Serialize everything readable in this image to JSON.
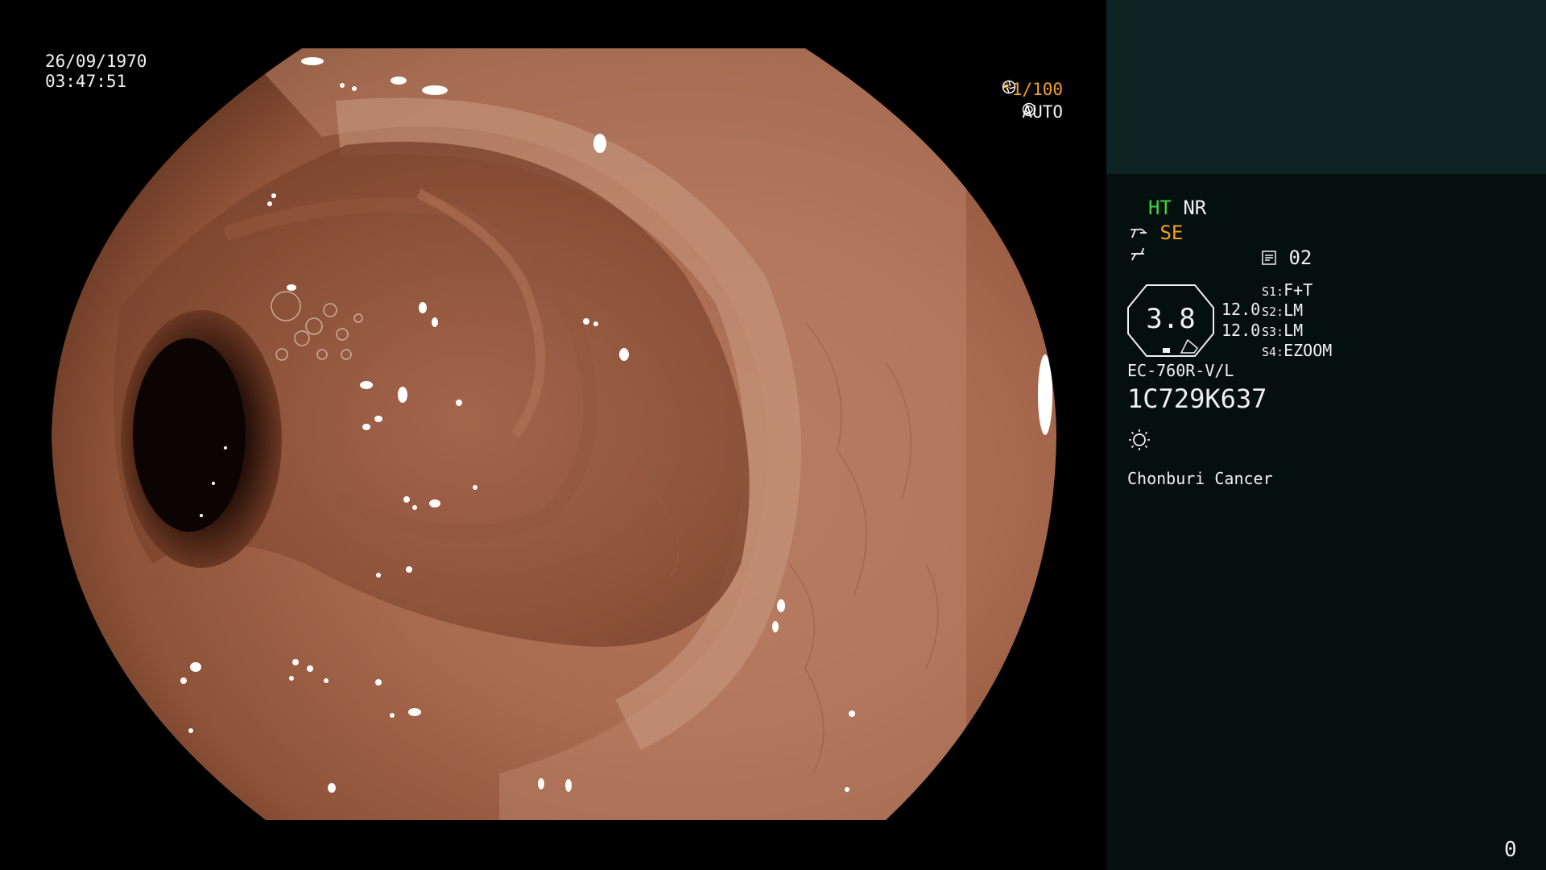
{
  "image_overlay": {
    "date": "26/09/1970",
    "time": "03:47:51",
    "shutter": "*1/100",
    "shutter_icon": "aperture-icon",
    "iris": "AUTO",
    "iris_icon": "iris-icon"
  },
  "panel": {
    "ht_label": "HT",
    "nr_label": "NR",
    "se_label": "SE",
    "se_icon": "enhancement-icon",
    "contrast_icon": "contrast-icon",
    "memory_icon": "memory-card-icon",
    "memory_value": "02",
    "gauge_value": "3.8",
    "gauge_line1": "12.0",
    "gauge_line2": "12.0",
    "switches": [
      {
        "key": "S1:",
        "value": "F+T"
      },
      {
        "key": "S2:",
        "value": "LM"
      },
      {
        "key": "S3:",
        "value": "LM"
      },
      {
        "key": "S4:",
        "value": "EZOOM"
      }
    ],
    "scope_model": "EC-760R-V/L",
    "serial": "1C729K637",
    "light_icon": "sun-icon",
    "institution": "Chonburi Cancer",
    "counter": "0"
  },
  "colors": {
    "mucosa": "#a86a4e",
    "lumen": "#1a0c07",
    "panel_top": "#0e2424",
    "panel_bottom": "#050f0d",
    "ht_green": "#3fd23f",
    "se_orange": "#f0a21c"
  }
}
